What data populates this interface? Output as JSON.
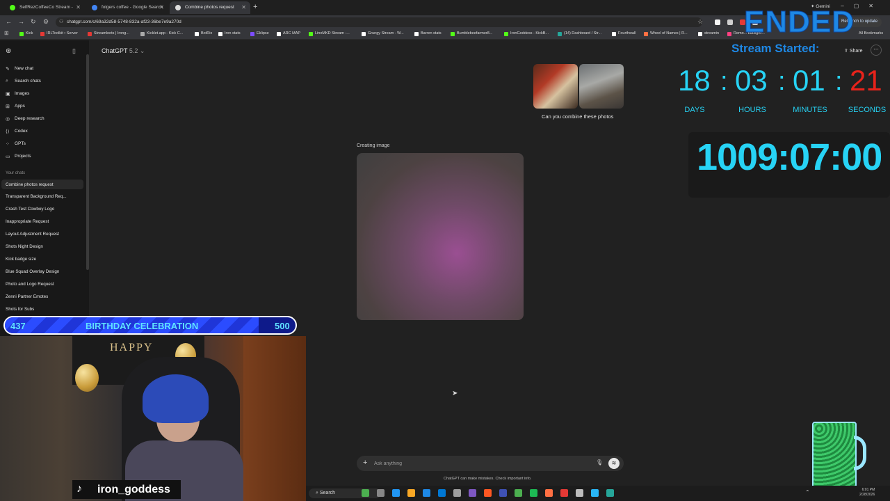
{
  "browser": {
    "tabs": [
      {
        "label": "SelfRezCoffeeCo Stream - ",
        "favicon_color": "#53fc18"
      },
      {
        "label": "folgers coffee - Google Search",
        "favicon_color": "#4285f4"
      },
      {
        "label": "Combine photos request",
        "favicon_color": "#dddddd"
      }
    ],
    "new_tab": "+",
    "gemini_label": "Gemini",
    "url": "chatgpt.com/c/69a32d58-5748-832a-af23-36be7e9a270d",
    "relaunch_label": "Relaunch to update",
    "bookmarks": [
      {
        "label": "Kick",
        "color": "#53fc18"
      },
      {
        "label": "IRLToolkit • Server",
        "color": "#e53935"
      },
      {
        "label": "Streamloots | Irong...",
        "color": "#e53935"
      },
      {
        "label": "Kicklet.app - Kick C...",
        "color": "#aaaaaa"
      },
      {
        "label": "BotRix",
        "color": "#ffffff"
      },
      {
        "label": "Iron stats",
        "color": "#ffffff"
      },
      {
        "label": "Eklipse",
        "color": "#7c4dff"
      },
      {
        "label": "ARC MAP",
        "color": "#ffffff"
      },
      {
        "label": "LinoMKD Stream -...",
        "color": "#53fc18"
      },
      {
        "label": "Grungy Stream - W...",
        "color": "#ffffff"
      },
      {
        "label": "Barren stats",
        "color": "#ffffff"
      },
      {
        "label": "Bumblebeefarmer8...",
        "color": "#53fc18"
      },
      {
        "label": "IronGoddess - KickB...",
        "color": "#53fc18"
      },
      {
        "label": "(14) Dashboard / Str...",
        "color": "#26a69a"
      },
      {
        "label": "Fourthwall",
        "color": "#ffffff"
      },
      {
        "label": "Wheel of Names | R...",
        "color": "#ff7043"
      },
      {
        "label": "streamin",
        "color": "#ffffff"
      },
      {
        "label": "Remo... backgro...",
        "color": "#ff4081"
      }
    ],
    "all_bookmarks": "All Bookmarks"
  },
  "sidebar": {
    "nav": [
      {
        "label": "New chat",
        "icon": "pencil-icon",
        "glyph": "✎"
      },
      {
        "label": "Search chats",
        "icon": "search-icon",
        "glyph": "⌕"
      },
      {
        "label": "Images",
        "icon": "image-icon",
        "glyph": "▣"
      },
      {
        "label": "Apps",
        "icon": "apps-icon",
        "glyph": "⊞"
      },
      {
        "label": "Deep research",
        "icon": "telescope-icon",
        "glyph": "◎"
      },
      {
        "label": "Codex",
        "icon": "code-icon",
        "glyph": "⟨⟩"
      },
      {
        "label": "GPTs",
        "icon": "gpts-icon",
        "glyph": "⁘"
      },
      {
        "label": "Projects",
        "icon": "folder-icon",
        "glyph": "▭"
      }
    ],
    "your_chats_label": "Your chats",
    "chats": [
      "Combine photos request",
      "Transparent Background Req...",
      "Crash Test Cowboy Logo",
      "Inappropriate Request",
      "Layout Adjustment Request",
      "Shots Night Design",
      "Kick badge size",
      "Blue Squad Overlay Design",
      "Photo and Logo Request",
      "Zenni Partner Emotes",
      "Shots for Subs"
    ]
  },
  "chat": {
    "model": "ChatGPT",
    "model_version": "5.2",
    "share_label": "Share",
    "user_message": "Can you combine these photos",
    "status": "Creating image",
    "composer_placeholder": "Ask anything",
    "disclaimer": "ChatGPT can make mistakes. Check important info."
  },
  "overlay": {
    "ended": "ENDED",
    "stream_started": "Stream Started:",
    "countdown": {
      "days": "18",
      "hours": "03",
      "minutes": "01",
      "seconds": "21",
      "days_label": "DAYS",
      "hours_label": "HOURS",
      "minutes_label": "MINUTES",
      "seconds_label": "SECONDS",
      "sep": ":"
    },
    "timer": "1009:07:00",
    "goal": {
      "current": "437",
      "title": "BIRTHDAY CELEBRATION",
      "target": "500",
      "progress": 0.874
    },
    "banner_text": "HAPPY",
    "username": "iron_goddess"
  },
  "taskbar": {
    "search_label": "Search",
    "clock_time": "6:01 PM",
    "clock_date": "2/28/2026",
    "icon_colors": [
      "#4caf50",
      "#888888",
      "#2196f3",
      "#f9a825",
      "#1e88e5",
      "#0078d4",
      "#9e9e9e",
      "#7e57c2",
      "#ff5722",
      "#3f51b5",
      "#4caf50",
      "#1db954",
      "#ff7043",
      "#e53935",
      "#bdbdbd",
      "#29b6f6",
      "#26a69a"
    ]
  }
}
